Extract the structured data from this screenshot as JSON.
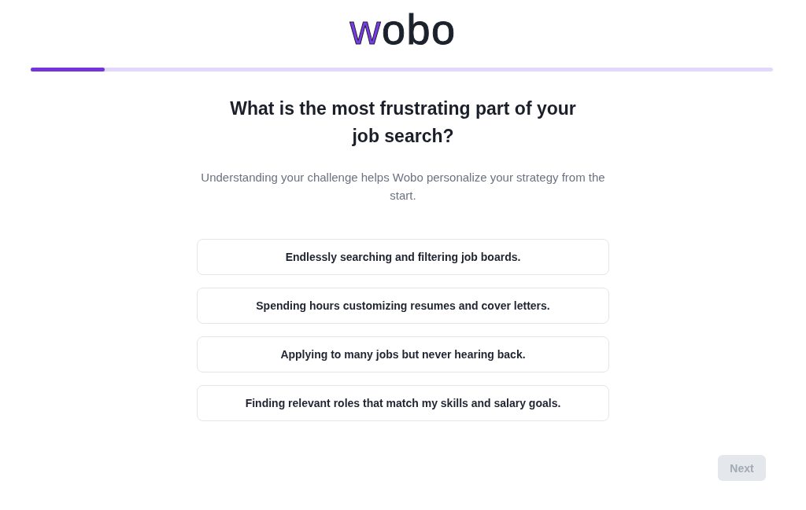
{
  "logo": "wobo",
  "progress": {
    "level": 0.1
  },
  "question": {
    "title": "What is the most frustrating part of your job search?",
    "subtitle": "Understanding your challenge helps Wobo personalize your strategy from the start."
  },
  "options": [
    {
      "label": "Endlessly searching and filtering job boards.",
      "selected": false
    },
    {
      "label": "Spending hours customizing resumes and cover letters.",
      "selected": false
    },
    {
      "label": "Applying to many jobs but never hearing back.",
      "selected": false
    },
    {
      "label": "Finding relevant roles that match my skills and salary goals.",
      "selected": false
    }
  ],
  "next_button": {
    "label": "Next",
    "disabled": true
  }
}
